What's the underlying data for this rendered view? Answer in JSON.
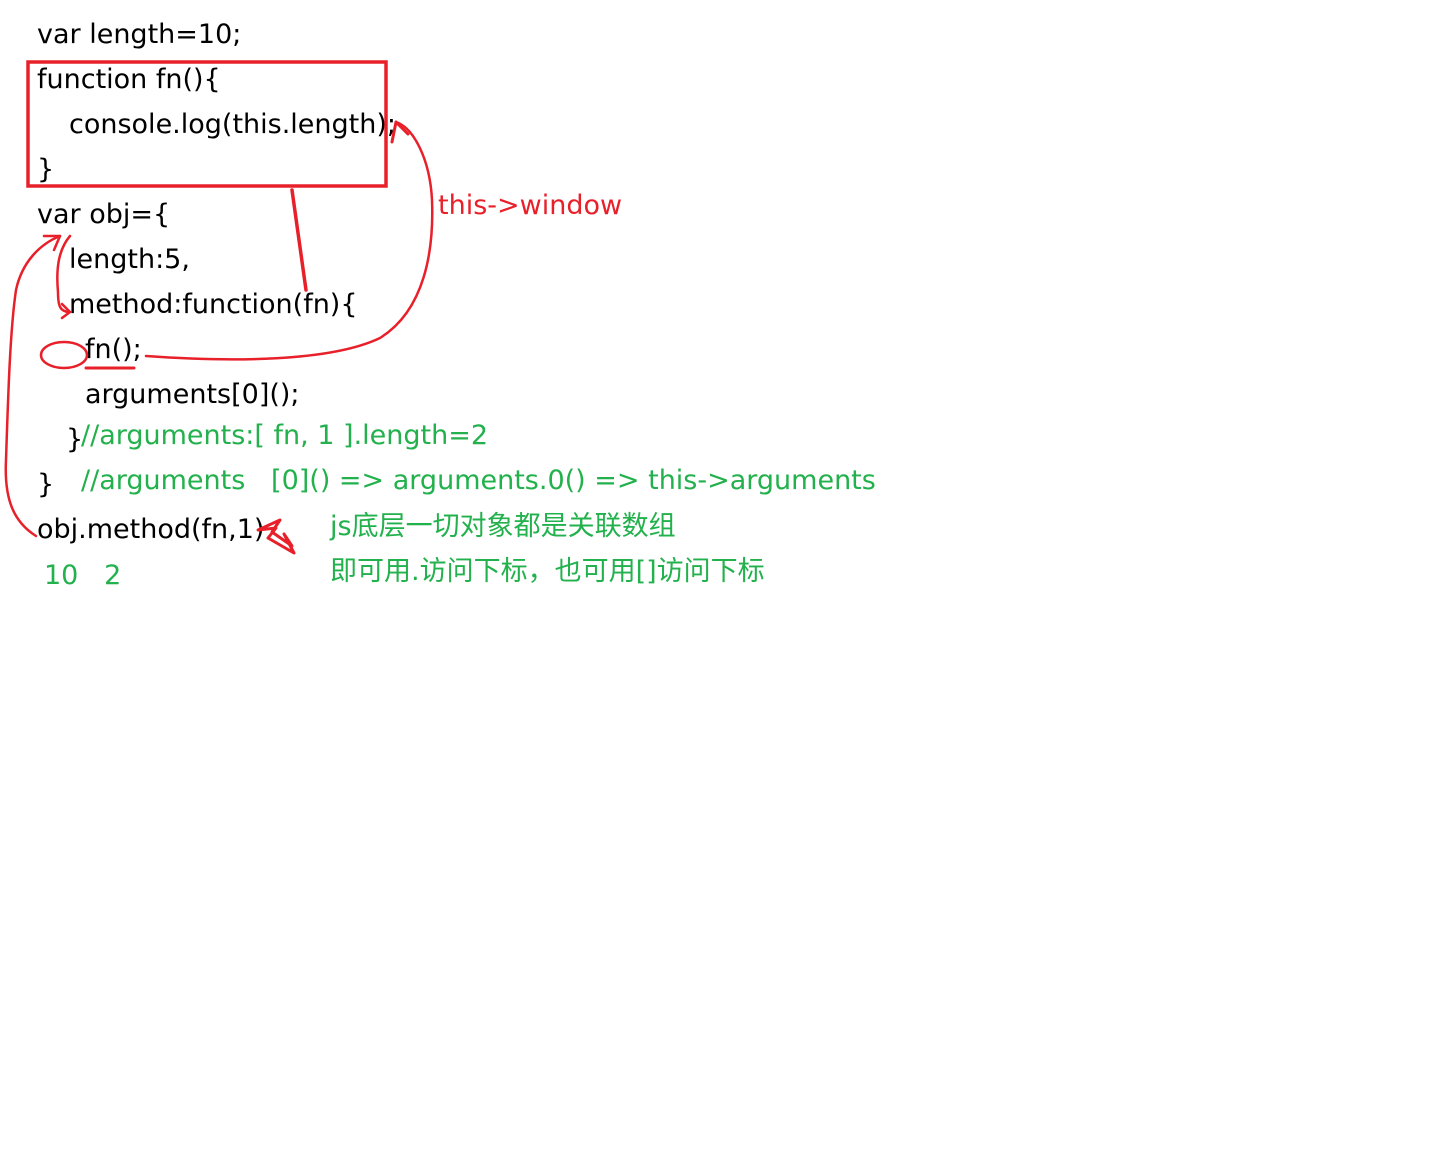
{
  "code_lines": [
    "var length=10;",
    "function fn(){",
    "console.log(this.length);",
    "}",
    "var obj={",
    "length:5,",
    "method:function(fn){",
    "fn();",
    "arguments[0]();",
    "}",
    "}",
    "obj.method(fn,1)"
  ],
  "comments": {
    "arguments_array": "//arguments:[ fn, 1 ].length=2",
    "arguments_call": "//arguments   [0]() => arguments.0() => this->arguments",
    "note_line1": "js底层一切对象都是关联数组",
    "note_line2": "即可用.访问下标，也可用[]访问下标",
    "output": "10   2"
  },
  "annotation": {
    "this_window": "this->window"
  },
  "colors": {
    "code": "#000000",
    "comment": "#22b14c",
    "annotation": "#e8202a"
  }
}
